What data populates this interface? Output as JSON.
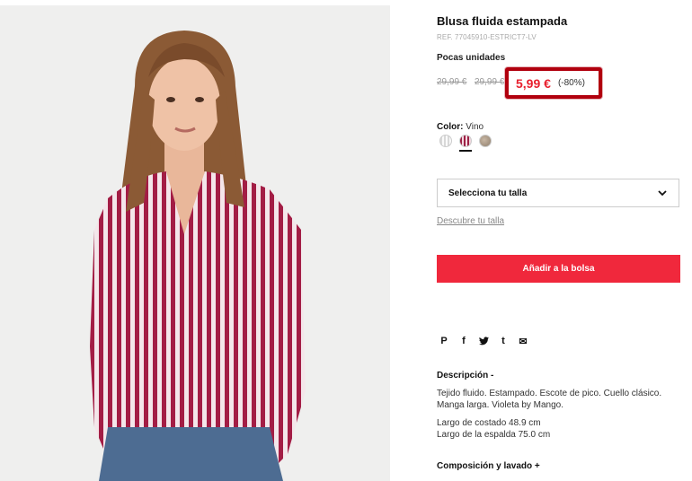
{
  "product": {
    "title": "Blusa fluida estampada",
    "ref": "REF. 77045910-ESTRICT7-LV",
    "stock_note": "Pocas unidades",
    "old_price_1": "29,99 €",
    "old_price_2": "29,99 €",
    "new_price": "5,99 €",
    "discount": "(-80%)",
    "accent_color": "#f0283c",
    "highlight_border_color": "#b1000e"
  },
  "color": {
    "label": "Color:",
    "value": "Vino",
    "swatches": [
      "striped-grey",
      "striped-wine",
      "taupe"
    ],
    "selected": "striped-wine"
  },
  "size": {
    "select_label": "Selecciona tu talla",
    "guide_link": "Descubre tu talla"
  },
  "actions": {
    "add_to_bag": "Añadir a la bolsa"
  },
  "share": {
    "icons": [
      "pinterest-icon",
      "facebook-icon",
      "twitter-icon",
      "tumblr-icon",
      "email-icon"
    ],
    "glyphs": [
      "P",
      "f",
      "t",
      "t",
      "✉"
    ]
  },
  "description": {
    "heading": "Descripción  -",
    "text_1": "Tejido fluido. Estampado. Escote de pico. Cuello clásico. Manga larga. Violeta by Mango.",
    "text_2": "Largo de costado 48.9 cm\nLargo de la espalda 75.0 cm"
  },
  "composition": {
    "heading": "Composición y lavado  +"
  }
}
